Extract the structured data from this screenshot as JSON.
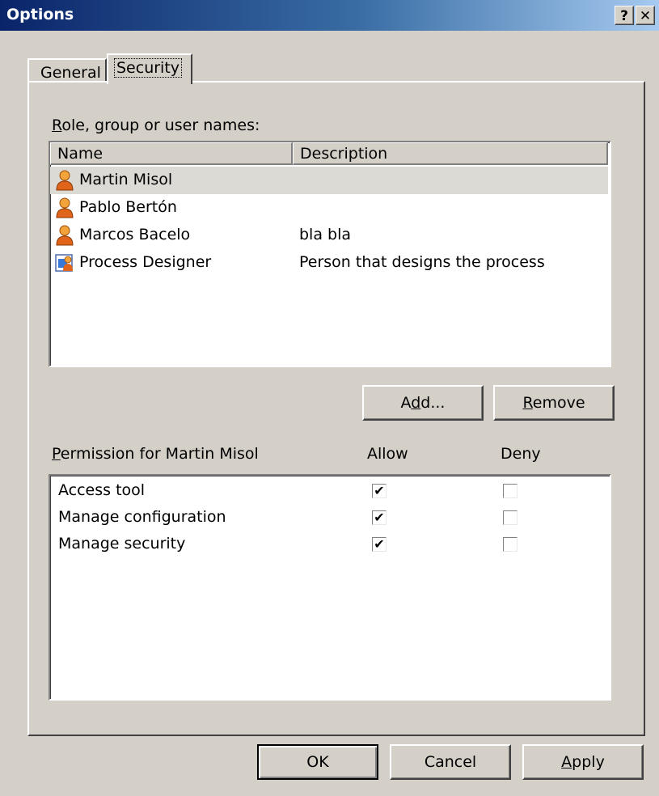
{
  "window": {
    "title": "Options",
    "help_label": "?",
    "close_label": "✕"
  },
  "tabs": [
    {
      "label": "General"
    },
    {
      "label": "Security",
      "active": true
    }
  ],
  "principals": {
    "label_mnemonic": "R",
    "label_rest": "ole, group or user names:",
    "columns": {
      "name": "Name",
      "description": "Description"
    },
    "rows": [
      {
        "name": "Martin Misol",
        "description": "",
        "icon": "user-icon",
        "selected": true
      },
      {
        "name": "Pablo Bertón",
        "description": "",
        "icon": "user-icon"
      },
      {
        "name": "Marcos Bacelo",
        "description": "bla bla",
        "icon": "user-icon"
      },
      {
        "name": "Process Designer",
        "description": "Person that designs the process",
        "icon": "role-icon"
      }
    ]
  },
  "buttons": {
    "add_pre": "A",
    "add_mnemonic": "d",
    "add_post": "d...",
    "remove_mnemonic": "R",
    "remove_rest": "emove",
    "ok": "OK",
    "cancel": "Cancel",
    "apply_mnemonic": "A",
    "apply_rest": "pply"
  },
  "permissions": {
    "label_mnemonic": "P",
    "label_rest": "ermission for Martin Misol",
    "allow_header": "Allow",
    "deny_header": "Deny",
    "rows": [
      {
        "name": "Access tool",
        "allow": true,
        "deny": false
      },
      {
        "name": "Manage configuration",
        "allow": true,
        "deny": false
      },
      {
        "name": "Manage security",
        "allow": true,
        "deny": false
      }
    ]
  },
  "colors": {
    "face": "#d4d0c8",
    "title_start": "#0a246a",
    "title_end": "#a6caf0",
    "selection": "#dcdad5"
  }
}
